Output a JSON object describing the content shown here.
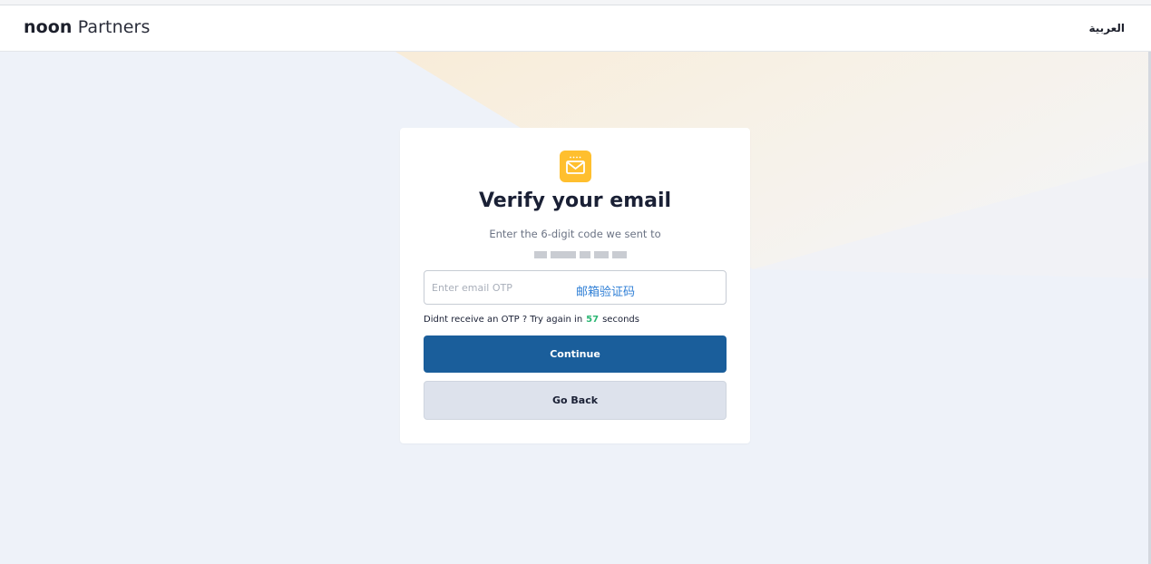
{
  "header": {
    "brand_strong": "noon",
    "brand_light": "Partners",
    "language_link": "العربية"
  },
  "card": {
    "icon": "mail-icon",
    "title": "Verify your email",
    "subtitle": "Enter the 6-digit code we sent to",
    "otp_placeholder": "Enter email OTP",
    "otp_value": "",
    "otp_note": "邮箱验证码",
    "resend_prefix": "Didnt receive an OTP ? Try again in",
    "resend_seconds": "57",
    "resend_suffix": "seconds",
    "continue_label": "Continue",
    "back_label": "Go Back"
  },
  "colors": {
    "accent": "#ffbf2e",
    "primary_button": "#1a5e9b",
    "countdown": "#2bb673",
    "background": "#eef2f9"
  }
}
